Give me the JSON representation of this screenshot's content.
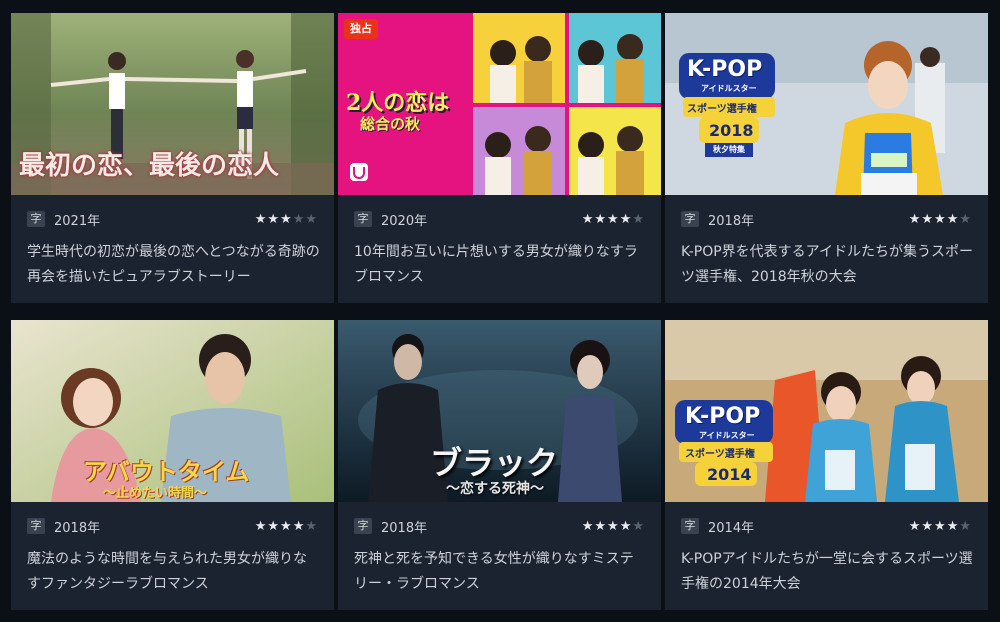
{
  "cards": [
    {
      "title_art": "最初の恋、最後の恋人",
      "sub": "字",
      "year": "2021年",
      "rating": 3,
      "description": "学生時代の初恋が最後の恋へとつながる奇跡の再会を描いたピュアラブストーリー"
    },
    {
      "badge": "独占",
      "title_art": "2人の恋は",
      "title_art_sub": "総合の秋",
      "sub": "字",
      "year": "2020年",
      "rating": 4,
      "description": "10年間お互いに片想いする男女が織りなすラブロマンス"
    },
    {
      "title_art": "K-POP",
      "title_art_sub": "スポーツ選手権",
      "title_art_year": "2018",
      "title_art_tag": "秋夕特集",
      "title_art_small": "アイドルスター",
      "sub": "字",
      "year": "2018年",
      "rating": 4,
      "description": "K-POP界を代表するアイドルたちが集うスポーツ選手権、2018年秋の大会"
    },
    {
      "title_art": "アバウトタイム",
      "title_art_sub": "～止めたい時間～",
      "sub": "字",
      "year": "2018年",
      "rating": 4,
      "description": "魔法のような時間を与えられた男女が織りなすファンタジーラブロマンス"
    },
    {
      "title_art": "ブラック",
      "title_art_sub": "～恋する死神～",
      "sub": "字",
      "year": "2018年",
      "rating": 4,
      "description": "死神と死を予知できる女性が織りなすミステリー・ラブロマンス"
    },
    {
      "title_art": "K-POP",
      "title_art_sub": "スポーツ選手権",
      "title_art_year": "2014",
      "title_art_small": "アイドルスター",
      "sub": "字",
      "year": "2014年",
      "rating": 4,
      "description": "K-POPアイドルたちが一堂に会するスポーツ選手権の2014年大会"
    }
  ],
  "colors": {
    "background": "#0b0f16",
    "card": "#1b2330",
    "badge_red": "#e8321a",
    "star_on": "#e9ebee",
    "star_off": "#5a6270"
  }
}
